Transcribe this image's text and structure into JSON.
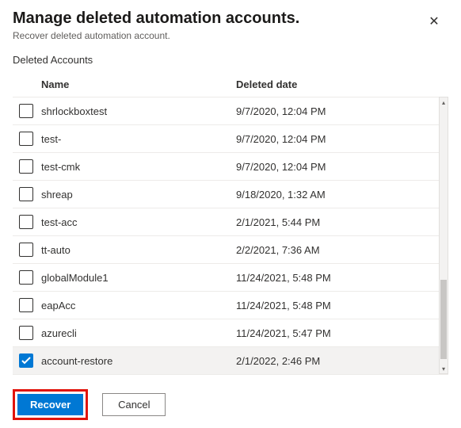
{
  "header": {
    "title": "Manage deleted automation accounts.",
    "subtitle": "Recover deleted automation account."
  },
  "section_label": "Deleted Accounts",
  "columns": {
    "name": "Name",
    "date": "Deleted date"
  },
  "rows": [
    {
      "name": "shrlockboxtest",
      "date": "9/7/2020, 12:04 PM",
      "checked": false
    },
    {
      "name": "test-",
      "date": "9/7/2020, 12:04 PM",
      "checked": false
    },
    {
      "name": "test-cmk",
      "date": "9/7/2020, 12:04 PM",
      "checked": false
    },
    {
      "name": "shreap",
      "date": "9/18/2020, 1:32 AM",
      "checked": false
    },
    {
      "name": "test-acc",
      "date": "2/1/2021, 5:44 PM",
      "checked": false
    },
    {
      "name": "tt-auto",
      "date": "2/2/2021, 7:36 AM",
      "checked": false
    },
    {
      "name": "globalModule1",
      "date": "11/24/2021, 5:48 PM",
      "checked": false
    },
    {
      "name": "eapAcc",
      "date": "11/24/2021, 5:48 PM",
      "checked": false
    },
    {
      "name": "azurecli",
      "date": "11/24/2021, 5:47 PM",
      "checked": false
    },
    {
      "name": "account-restore",
      "date": "2/1/2022, 2:46 PM",
      "checked": true
    }
  ],
  "footer": {
    "recover": "Recover",
    "cancel": "Cancel"
  }
}
